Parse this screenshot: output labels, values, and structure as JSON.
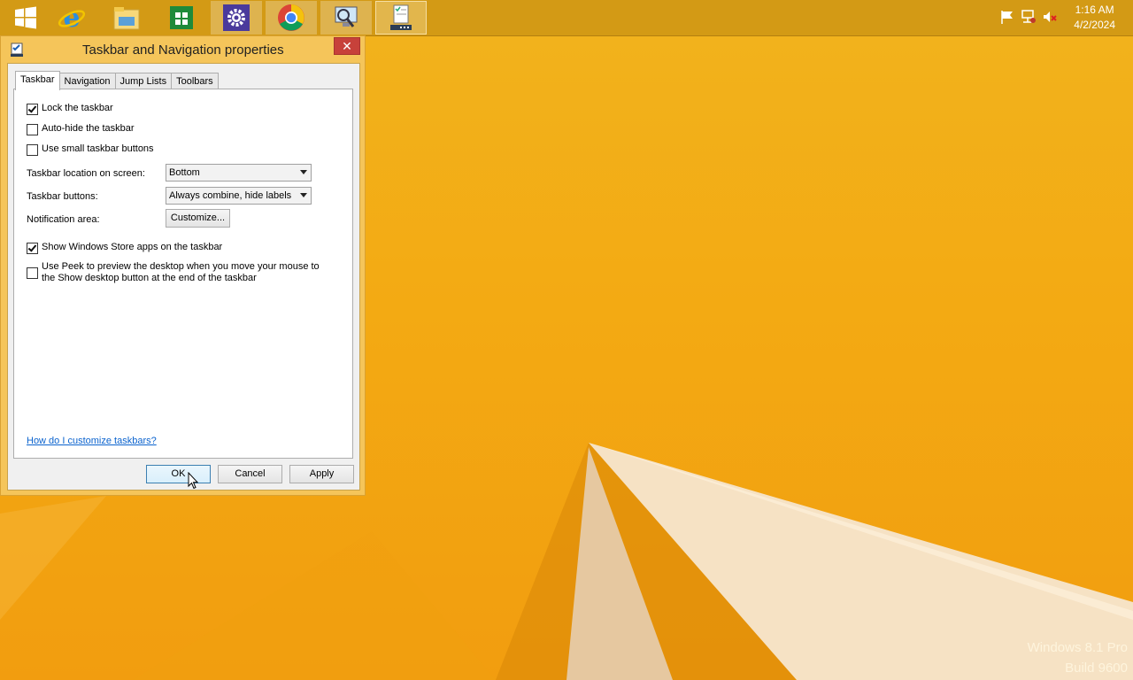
{
  "taskbar": {
    "buttons": [
      {
        "name": "start",
        "icon": "windows-logo-icon"
      },
      {
        "name": "internet-explorer",
        "icon": "ie-icon"
      },
      {
        "name": "file-explorer",
        "icon": "folder-icon"
      },
      {
        "name": "store",
        "icon": "store-icon"
      },
      {
        "name": "settings",
        "icon": "gear-icon"
      },
      {
        "name": "chrome",
        "icon": "chrome-icon"
      },
      {
        "name": "search-computer",
        "icon": "magnifier-computer-icon"
      },
      {
        "name": "taskbar-properties",
        "icon": "taskbar-properties-icon",
        "active": true
      }
    ],
    "tray": [
      "flag-icon",
      "network-icon",
      "speaker-muted-icon"
    ],
    "clock": {
      "time": "1:16 AM",
      "date": "4/2/2024"
    }
  },
  "dialog": {
    "title": "Taskbar and Navigation properties",
    "close_label": "✕",
    "tabs": [
      "Taskbar",
      "Navigation",
      "Jump Lists",
      "Toolbars"
    ],
    "selected_tab": "Taskbar",
    "checkboxes": {
      "lock": {
        "label": "Lock the taskbar",
        "checked": true
      },
      "autohide": {
        "label": "Auto-hide the taskbar",
        "checked": false
      },
      "small": {
        "label": "Use small taskbar buttons",
        "checked": false
      },
      "store_apps": {
        "label": "Show Windows Store apps on the taskbar",
        "checked": true
      },
      "peek": {
        "label": "Use Peek to preview the desktop when you move your mouse to the Show desktop button at the end of the taskbar",
        "checked": false
      }
    },
    "location_label": "Taskbar location on screen:",
    "location_value": "Bottom",
    "buttons_label": "Taskbar buttons:",
    "buttons_value": "Always combine, hide labels",
    "notification_label": "Notification area:",
    "customize_label": "Customize...",
    "help_link": "How do I customize taskbars?",
    "ok_label": "OK",
    "cancel_label": "Cancel",
    "apply_label": "Apply"
  },
  "watermark": {
    "line1": "Windows 8.1 Pro",
    "line2": "Build 9600"
  },
  "colors": {
    "accent": "#f3aa13",
    "taskbar": "#ce9614",
    "close": "#c7413a",
    "link": "#0b63ce"
  }
}
